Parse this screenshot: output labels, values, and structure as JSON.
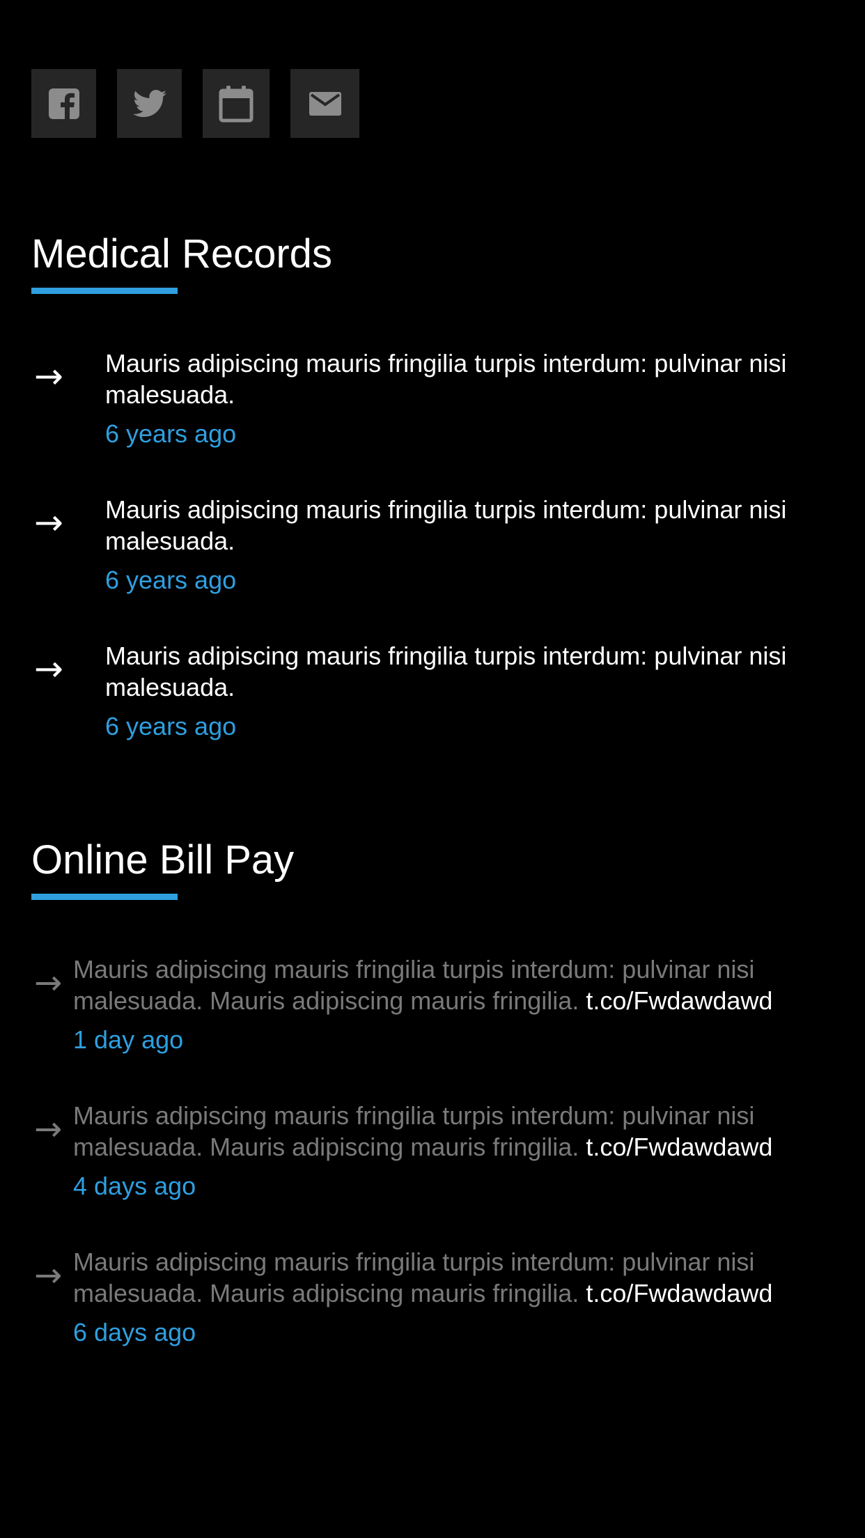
{
  "social": [
    {
      "icon": "facebook-icon"
    },
    {
      "icon": "twitter-icon"
    },
    {
      "icon": "calendar-icon"
    },
    {
      "icon": "mail-icon"
    }
  ],
  "colors": {
    "background": "#000000",
    "tile": "#262626",
    "icon": "#8c8c8c",
    "accent": "#2f9fe0",
    "muted_text": "#7a7a7a",
    "text": "#ffffff"
  },
  "arrow_glyph": "→",
  "medical_records": {
    "title": "Medical Records",
    "items": [
      {
        "text": "Mauris adipiscing mauris fringilia turpis interdum: pulvinar nisi malesuada.",
        "time": "6 years ago"
      },
      {
        "text": "Mauris adipiscing mauris fringilia turpis interdum: pulvinar nisi malesuada.",
        "time": "6 years ago"
      },
      {
        "text": "Mauris adipiscing mauris fringilia turpis interdum: pulvinar nisi malesuada.",
        "time": "6 years ago"
      }
    ]
  },
  "online_bill_pay": {
    "title": "Online Bill Pay",
    "items": [
      {
        "text": "Mauris adipiscing mauris fringilia turpis interdum: pulvinar nisi malesuada. Mauris adipiscing mauris fringilia.",
        "link": "t.co/Fwdawdawd",
        "time": "1 day ago"
      },
      {
        "text": "Mauris adipiscing mauris fringilia turpis interdum: pulvinar nisi malesuada. Mauris adipiscing mauris fringilia.",
        "link": "t.co/Fwdawdawd",
        "time": "4 days ago"
      },
      {
        "text": "Mauris adipiscing mauris fringilia turpis interdum: pulvinar nisi malesuada. Mauris adipiscing mauris fringilia.",
        "link": "t.co/Fwdawdawd",
        "time": "6 days ago"
      }
    ]
  }
}
